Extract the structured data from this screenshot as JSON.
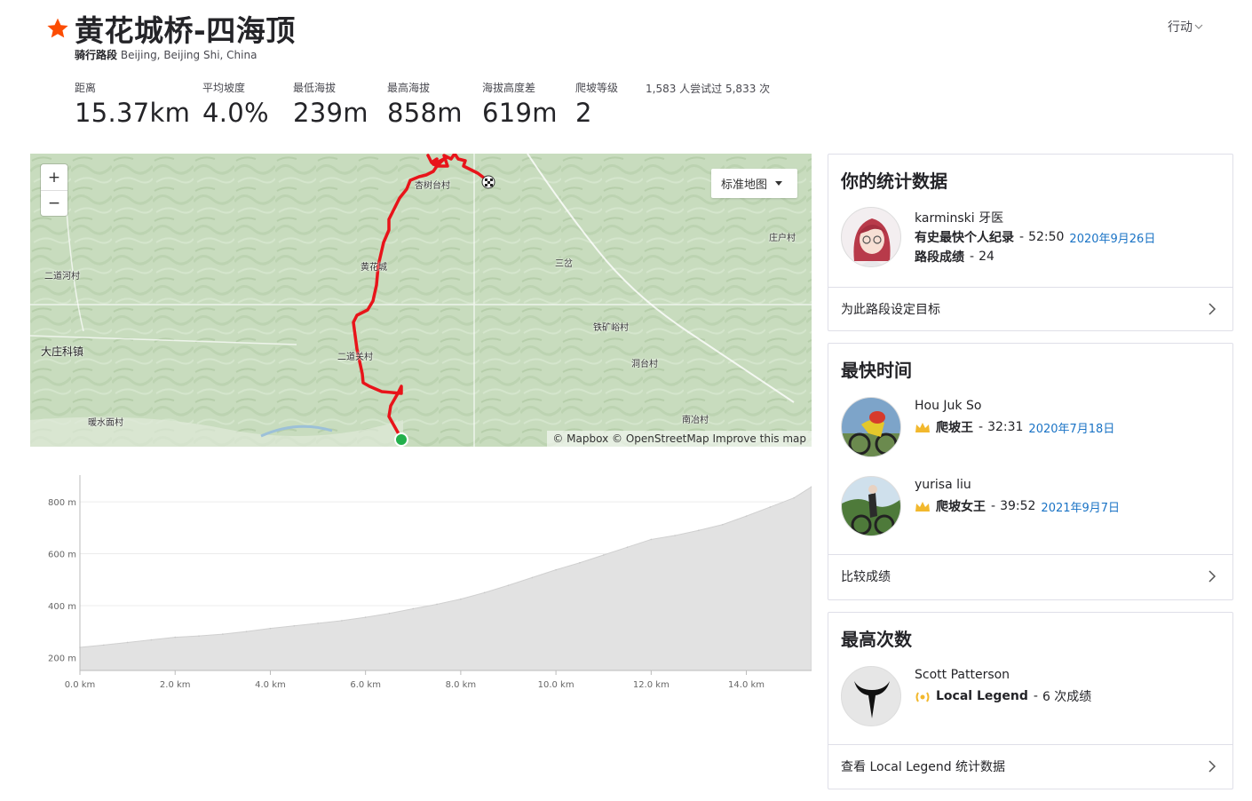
{
  "segment": {
    "title": "黄花城桥-四海顶",
    "type_label": "骑行路段",
    "location": "Beijing, Beijing Shi, China",
    "actions_label": "行动",
    "stats": [
      {
        "label": "距离",
        "value": "15.37km"
      },
      {
        "label": "平均坡度",
        "value": "4.0%"
      },
      {
        "label": "最低海拔",
        "value": "239m"
      },
      {
        "label": "最高海拔",
        "value": "858m"
      },
      {
        "label": "海拔高度差",
        "value": "619m"
      },
      {
        "label": "爬坡等级",
        "value": "2"
      }
    ],
    "attempts": "1,583 人尝试过 5,833 次"
  },
  "map": {
    "zoom_in": "+",
    "zoom_out": "−",
    "map_type": "标准地图",
    "attribution": "© Mapbox © OpenStreetMap Improve this map",
    "places": [
      "杏树台村",
      "庄户村",
      "二道河村",
      "三岔",
      "铁矿峪村",
      "大庄科镇",
      "二道关村",
      "洞台村",
      "暖水面村",
      "南冶村",
      "黄花城"
    ],
    "colors": {
      "route": "#e8141a",
      "start": "#22b04b",
      "terrain": "#c9dcc0"
    }
  },
  "elevation": {
    "y_ticks": [
      "800 m",
      "600 m",
      "400 m",
      "200 m"
    ],
    "x_ticks": [
      "0.0 km",
      "2.0 km",
      "4.0 km",
      "6.0 km",
      "8.0 km",
      "10.0 km",
      "12.0 km",
      "14.0 km"
    ]
  },
  "chart_data": {
    "type": "area",
    "x": [
      0,
      0.5,
      1,
      1.5,
      2,
      2.5,
      3,
      3.5,
      4,
      4.5,
      5,
      5.5,
      6,
      6.5,
      7,
      7.5,
      8,
      8.5,
      9,
      9.5,
      10,
      10.5,
      11,
      11.5,
      12,
      12.5,
      13,
      13.5,
      14,
      14.5,
      15,
      15.37
    ],
    "values": [
      239,
      248,
      258,
      268,
      278,
      283,
      290,
      300,
      312,
      322,
      332,
      342,
      355,
      370,
      388,
      405,
      425,
      450,
      478,
      508,
      538,
      565,
      595,
      625,
      655,
      670,
      690,
      712,
      745,
      780,
      815,
      858
    ],
    "xlabel": "",
    "ylabel": "",
    "xlim": [
      0,
      15.37
    ],
    "ylim": [
      150,
      920
    ],
    "grid": true
  },
  "your_stats": {
    "title": "你的统计数据",
    "name": "karminski 牙医",
    "pr_label": "有史最快个人纪录",
    "pr_value": "52:50",
    "pr_date": "2020年9月26日",
    "efforts_label": "路段成绩",
    "efforts_value": "24",
    "goal_label": "为此路段设定目标"
  },
  "fastest": {
    "title": "最快时间",
    "people": [
      {
        "name": "Hou Juk So",
        "award": "爬坡王",
        "time": "32:31",
        "date": "2020年7月18日"
      },
      {
        "name": "yurisa liu",
        "award": "爬坡女王",
        "time": "39:52",
        "date": "2021年9月7日"
      }
    ],
    "compare_label": "比较成绩"
  },
  "most_efforts": {
    "title": "最高次数",
    "name": "Scott Patterson",
    "award": "Local Legend",
    "count": "6 次成绩",
    "view_label": "查看 Local Legend 统计数据"
  }
}
